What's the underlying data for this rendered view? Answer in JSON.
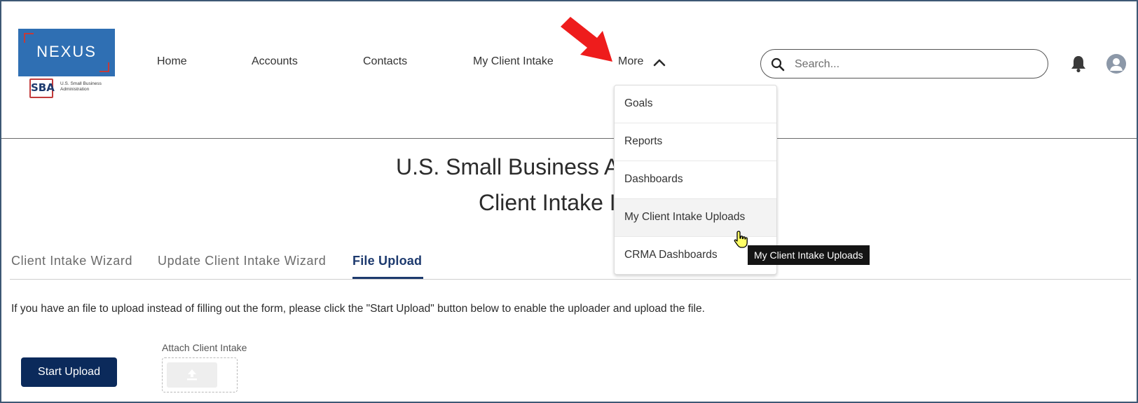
{
  "logo": {
    "name": "NEXUS",
    "agency_mark": "SBA",
    "agency_name": "U.S. Small Business Administration"
  },
  "nav": {
    "items": [
      {
        "label": "Home"
      },
      {
        "label": "Accounts"
      },
      {
        "label": "Contacts"
      },
      {
        "label": "My Client Intake"
      },
      {
        "label": "More",
        "icon": "chevron-up-icon",
        "expanded": true
      }
    ]
  },
  "search": {
    "placeholder": "Search...",
    "value": ""
  },
  "header_icons": {
    "notifications": "bell-icon",
    "user": "avatar-icon"
  },
  "page": {
    "title_line1": "U.S. Small Business Ad",
    "title_line2": "Client Intake I"
  },
  "tabs": [
    {
      "label": "Client Intake Wizard",
      "active": false
    },
    {
      "label": "Update Client Intake Wizard",
      "active": false
    },
    {
      "label": "File Upload",
      "active": true
    }
  ],
  "upload": {
    "instructions": "If you have an file to upload instead of filling out the form, please click the \"Start Upload\" button below to enable the uploader and upload the file.",
    "start_button": "Start Upload",
    "attach_label": "Attach Client Intake",
    "attach_icon": "upload-icon"
  },
  "more_menu": {
    "items": [
      {
        "label": "Goals"
      },
      {
        "label": "Reports"
      },
      {
        "label": "Dashboards"
      },
      {
        "label": "My Client Intake Uploads",
        "hovered": true
      },
      {
        "label": "CRMA Dashboards"
      }
    ]
  },
  "tooltip": {
    "text": "My Client Intake Uploads"
  },
  "colors": {
    "brand_navy": "#0b2a5b",
    "logo_blue": "#2f6fb3",
    "accent_red": "#c23b3b",
    "annotation_arrow": "#ee1c1c",
    "active_tab": "#1d3a6e"
  }
}
